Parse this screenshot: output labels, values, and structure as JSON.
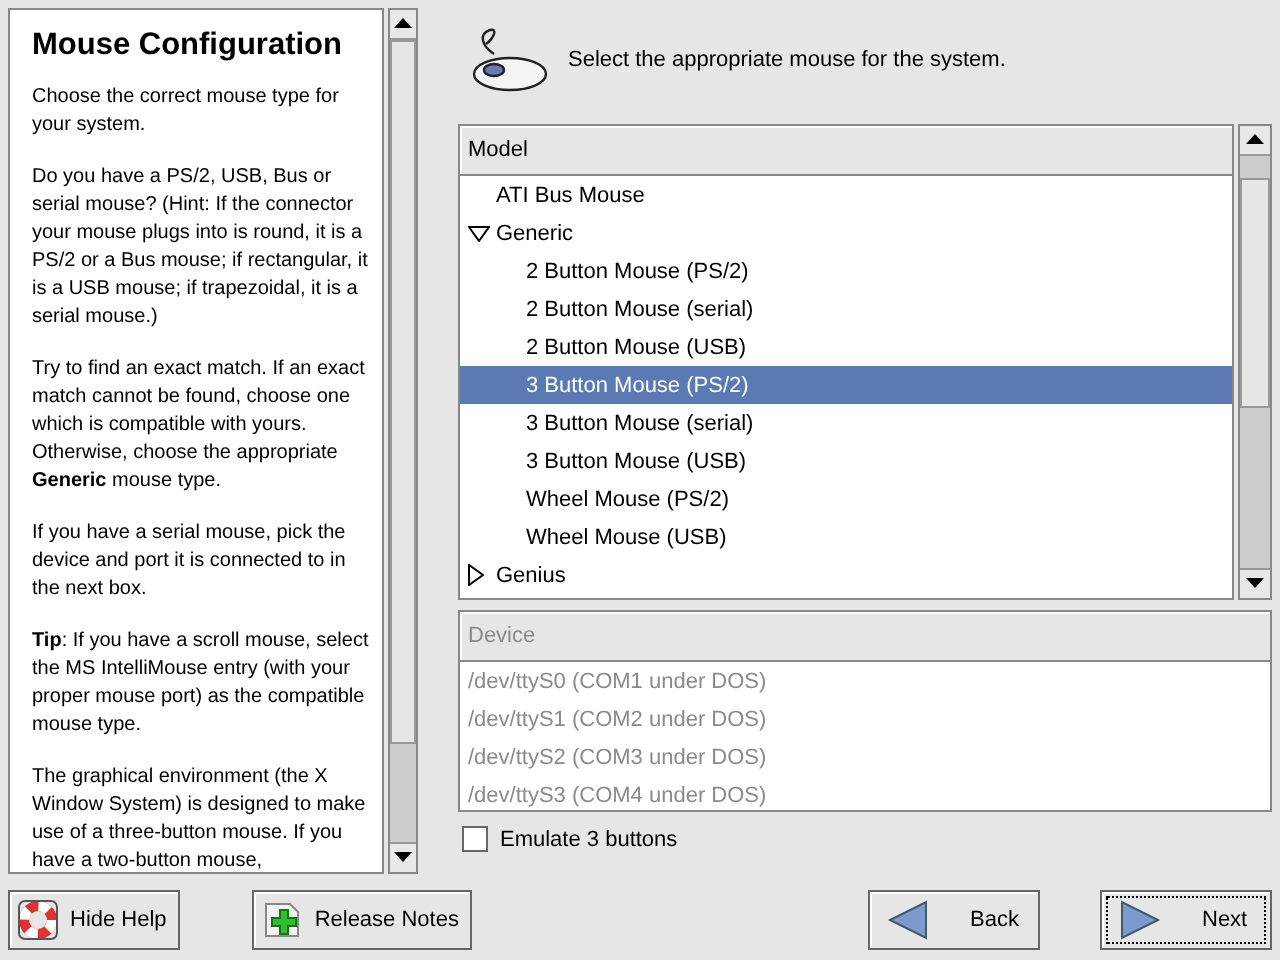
{
  "help": {
    "title": "Mouse Configuration",
    "paragraphs": [
      "Choose the correct mouse type for your system.",
      "Do you have a PS/2, USB, Bus or serial mouse? (Hint: If the connector your mouse plugs into is round, it is a PS/2 or a Bus mouse; if rectangular, it is a USB mouse; if trapezoidal, it is a serial mouse.)",
      "Try to find an exact match. If an exact match cannot be found, choose one which is compatible with yours. Otherwise, choose the appropriate **Generic** mouse type.",
      "If you have a serial mouse, pick the device and port it is connected to in the next box.",
      "**Tip**: If you have a scroll mouse, select the MS IntelliMouse entry (with your proper mouse port) as the compatible mouse type.",
      "The graphical environment (the X Window System) is designed to make use of a three-button mouse. If you have a two-button mouse,"
    ]
  },
  "prompt": "Select the appropriate mouse for the system.",
  "model_list": {
    "header": "Model",
    "items": [
      {
        "kind": "leaf",
        "label": "ATI Bus Mouse",
        "selected": false
      },
      {
        "kind": "group",
        "label": "Generic",
        "expanded": true,
        "selected": false,
        "children": [
          {
            "kind": "leaf",
            "label": "2 Button Mouse (PS/2)",
            "selected": false
          },
          {
            "kind": "leaf",
            "label": "2 Button Mouse (serial)",
            "selected": false
          },
          {
            "kind": "leaf",
            "label": "2 Button Mouse (USB)",
            "selected": false
          },
          {
            "kind": "leaf",
            "label": "3 Button Mouse (PS/2)",
            "selected": true
          },
          {
            "kind": "leaf",
            "label": "3 Button Mouse (serial)",
            "selected": false
          },
          {
            "kind": "leaf",
            "label": "3 Button Mouse (USB)",
            "selected": false
          },
          {
            "kind": "leaf",
            "label": "Wheel Mouse (PS/2)",
            "selected": false
          },
          {
            "kind": "leaf",
            "label": "Wheel Mouse (USB)",
            "selected": false
          }
        ]
      },
      {
        "kind": "group",
        "label": "Genius",
        "expanded": false,
        "selected": false
      }
    ]
  },
  "device_list": {
    "header": "Device",
    "disabled": true,
    "items": [
      "/dev/ttyS0 (COM1 under DOS)",
      "/dev/ttyS1 (COM2 under DOS)",
      "/dev/ttyS2 (COM3 under DOS)",
      "/dev/ttyS3 (COM4 under DOS)"
    ]
  },
  "emulate_3_buttons": {
    "label": "Emulate 3 buttons",
    "checked": false
  },
  "buttons": {
    "hide_help": "Hide Help",
    "release_notes": "Release Notes",
    "back": "Back",
    "next": "Next"
  }
}
